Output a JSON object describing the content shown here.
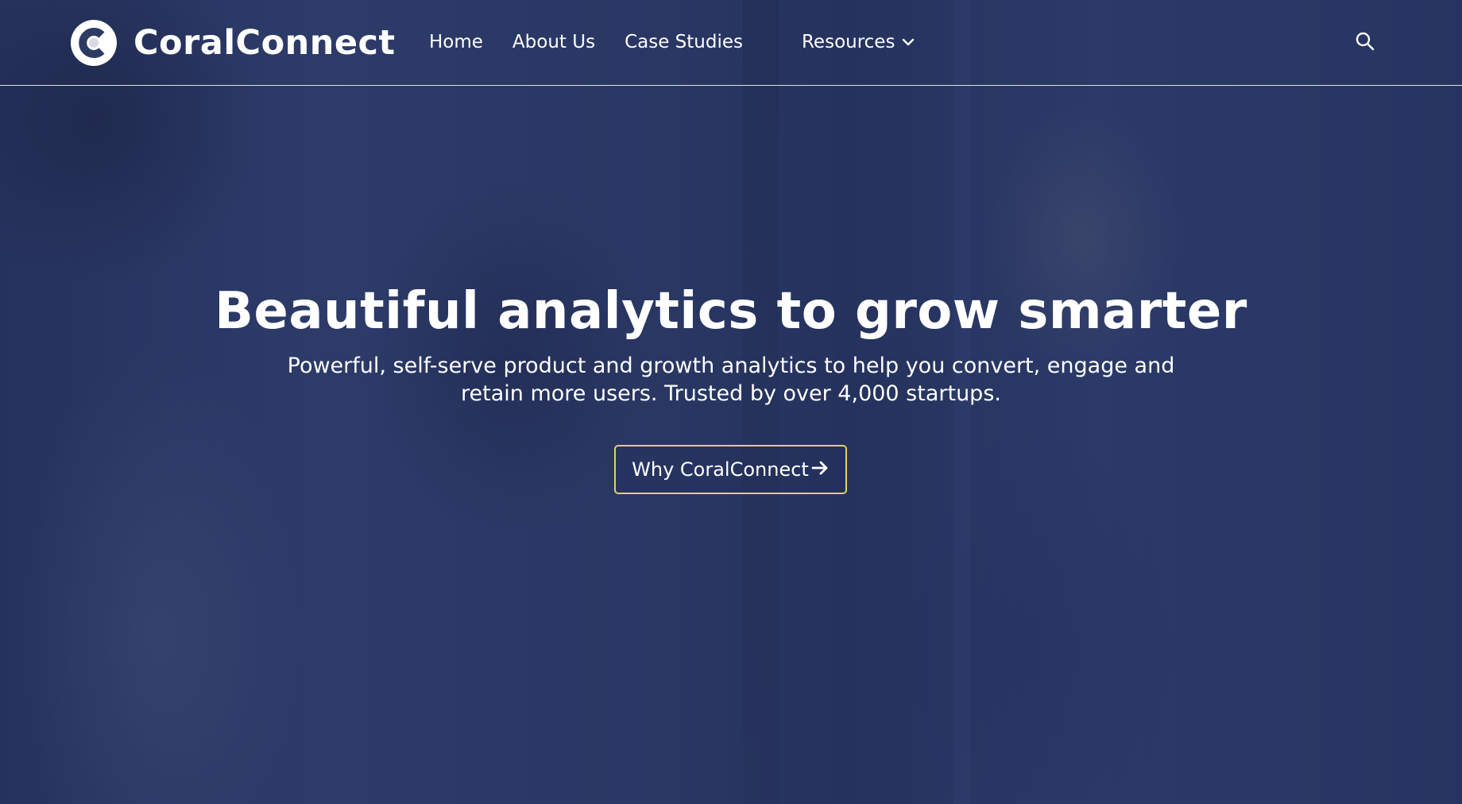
{
  "brand": {
    "name": "CoralConnect",
    "logo_icon": "coralconnect-logo-icon"
  },
  "nav": {
    "items": [
      {
        "label": "Home"
      },
      {
        "label": "About Us"
      },
      {
        "label": "Case Studies"
      },
      {
        "label": "Resources",
        "has_dropdown": true,
        "icon": "chevron-down-icon"
      }
    ],
    "search_icon": "search-icon"
  },
  "hero": {
    "title": "Beautiful analytics to grow smarter",
    "subtitle": "Powerful, self-serve product and growth analytics to help you convert, engage and retain more users. Trusted by over 4,000 startups.",
    "cta_label": "Why CoralConnect",
    "cta_icon": "arrow-right-icon"
  },
  "colors": {
    "overlay": "#23305c",
    "text": "#ffffff",
    "cta_border": "#e2cf6a"
  }
}
